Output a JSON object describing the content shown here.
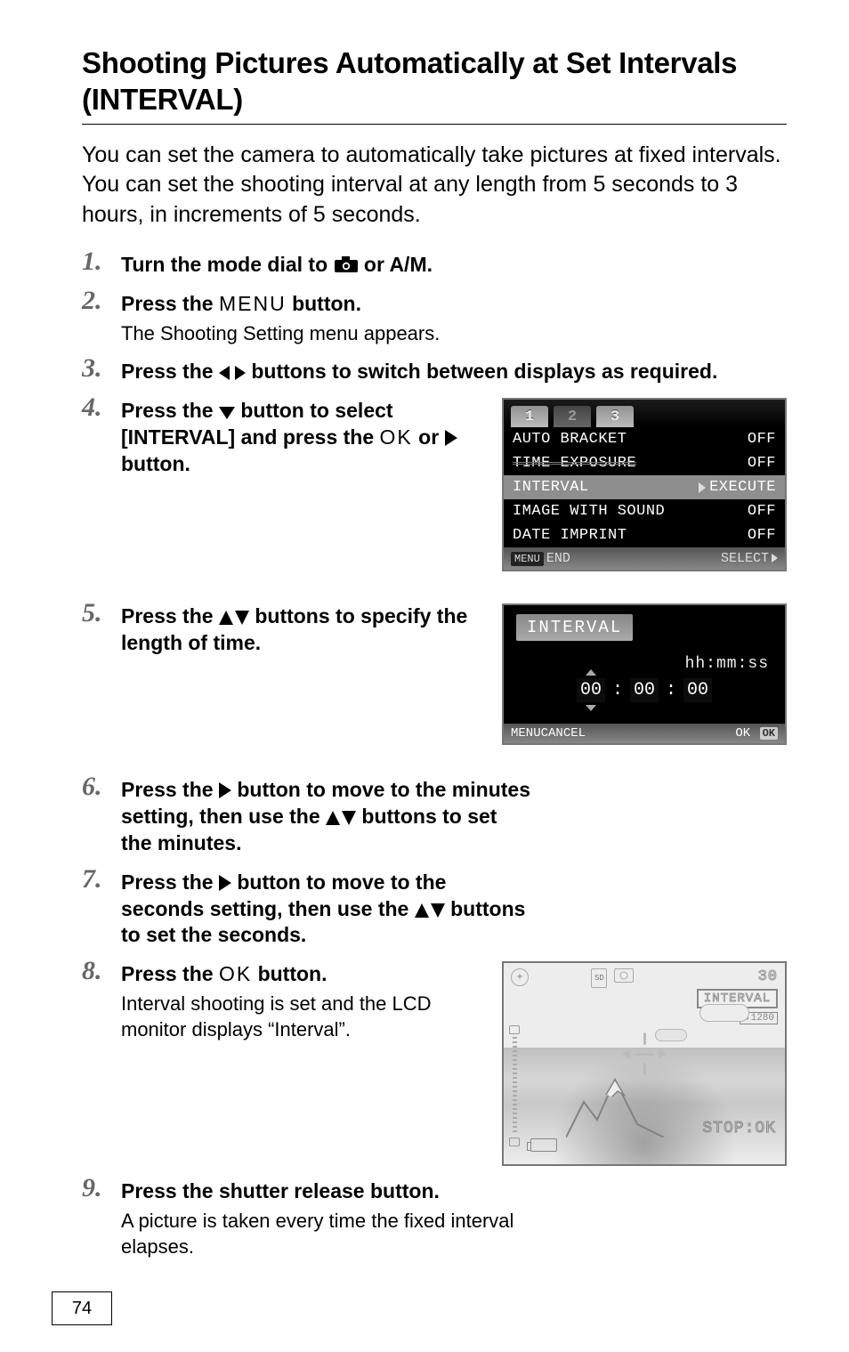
{
  "title": "Shooting Pictures Automatically at Set Intervals (INTERVAL)",
  "intro": "You can set the camera to automatically take pictures at fixed intervals.\nYou can set the shooting interval at any length from 5 seconds to 3 hours, in increments of 5 seconds.",
  "steps": {
    "s1": {
      "a": "Turn the mode dial to ",
      "b": " or A/M."
    },
    "s2": {
      "a": "Press the ",
      "menu": "MENU",
      "b": " button.",
      "body": "The Shooting Setting menu appears."
    },
    "s3": {
      "a": "Press the ",
      "b": " buttons to switch between displays as required."
    },
    "s4": {
      "a": "Press the ",
      "b": " button to select [INTERVAL] and press the ",
      "ok": "OK",
      "c": " or ",
      "d": " button."
    },
    "s5": {
      "a": "Press the ",
      "b": " buttons to specify the length of time."
    },
    "s6": {
      "a": "Press the ",
      "b": " button to move to the minutes setting, then use the ",
      "c": " buttons to set the minutes."
    },
    "s7": {
      "a": "Press the ",
      "b": " button to move to the seconds setting, then use the ",
      "c": " buttons to set the seconds."
    },
    "s8": {
      "a": "Press the ",
      "ok": "OK",
      "b": " button.",
      "body": "Interval shooting is set and the LCD monitor displays “Interval”."
    },
    "s9": {
      "a": "Press the shutter release button.",
      "body": "A picture is taken every time the fixed interval elapses."
    }
  },
  "menuShot": {
    "tabs": [
      "1",
      "2",
      "3"
    ],
    "rows": [
      {
        "label": "AUTO BRACKET",
        "value": "OFF"
      },
      {
        "label": "TIME EXPOSURE",
        "value": "OFF"
      },
      {
        "label": "INTERVAL",
        "value": "EXECUTE"
      },
      {
        "label": "IMAGE WITH SOUND",
        "value": "OFF"
      },
      {
        "label": "DATE IMPRINT",
        "value": "OFF"
      }
    ],
    "footerLeft": "MENU",
    "footerLeft2": "END",
    "footerRight": "SELECT"
  },
  "intervalShot": {
    "title": "INTERVAL",
    "format": "hh:mm:ss",
    "hh": "00",
    "mm": "00",
    "ss": "00",
    "footerLeft": "MENU",
    "footerLeft2": "CANCEL",
    "footerRight": "OK",
    "okBox": "OK"
  },
  "cameraShot": {
    "sd": "SD",
    "count": "30",
    "badge": "INTERVAL",
    "size": "1280",
    "bottomRight": "STOP:OK"
  },
  "pageNumber": "74"
}
